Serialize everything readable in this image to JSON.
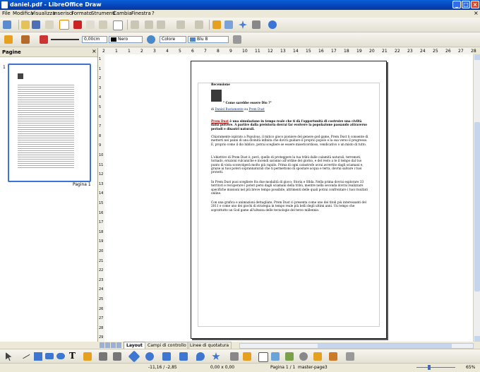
{
  "window": {
    "title": "daniel.pdf - LibreOffice Draw"
  },
  "menu": [
    "File",
    "Modifica",
    "Visualizza",
    "Inserisci",
    "Formato",
    "Strumenti",
    "Cambia",
    "Finestra",
    "?"
  ],
  "format_bar": {
    "line_width": "0,00cm",
    "line_color": "Nero",
    "area_style": "Colore",
    "area_color": "Blu 8"
  },
  "slide_pane": {
    "title": "Pagine",
    "page_number": "1",
    "page_label": "Pagina 1"
  },
  "ruler": {
    "labels": [
      "2",
      "1",
      "1",
      "2",
      "3",
      "4",
      "5",
      "6",
      "7",
      "8",
      "9",
      "10",
      "11",
      "12",
      "13",
      "14",
      "15",
      "16",
      "17",
      "18",
      "19",
      "20",
      "21",
      "22",
      "23",
      "24",
      "25",
      "26",
      "27",
      "28"
    ]
  },
  "vruler_labels": [
    "1",
    "1",
    "2",
    "3",
    "4",
    "5",
    "6",
    "7",
    "8",
    "9",
    "10",
    "11",
    "12",
    "13",
    "14",
    "15",
    "16",
    "17",
    "18",
    "19",
    "20",
    "21",
    "22",
    "23",
    "24",
    "25",
    "26",
    "27",
    "28",
    "29"
  ],
  "tabs": [
    "Layout",
    "Campi di controllo",
    "Linee di quotatura"
  ],
  "status": {
    "position": "-11,16 / -2,85",
    "size": "0,00 x 0,00",
    "page": "Pagina 1 / 1",
    "master": "master-page3",
    "zoom": "65%"
  },
  "doc": {
    "heading": "Recensione",
    "quote": "\" Come sarebbe essere Dio ?\"",
    "byline_prefix": "di",
    "author": "Daniel Bustamente",
    "byline_mid": "su",
    "game_link": "Prem Dust",
    "intro_bold_link": "Prem Dust",
    "intro_bold": "è una simulazione in tempo reale che ti dà l'opportunità di costruire una civiltà dalla polvere. A partire dalla preistoria dovrai far evolvere la popolazione passando attraverso periodi e disastri naturali.",
    "p1": "Chiaramente ispirato a Populous, il mitico gioco pioniere del genere god game, Prem Dust ti consente di metterti nei panni di una divinità infinita che dovrà guidare il proprio popolo e la sua verso il progresso. E, proprio come il dio biblico, potrai scegliere se essere misericordioso, vendicativo o un misto di tutto.",
    "p2": "L'obiettivo di Prem Dust è, però, quello di proteggere la tua tribù dalle calamità naturali, terremoti, tornado, eruzioni vulcaniche e incendi saranno all'ordine del giorno, e del resto a te il tempo dal tuo punto di vista sconvolgerà molto più rapido. Prima di ogni catastrofe avrai avvertito dagli sciamani e, grazie ai tuoi poteri soprannaturali che ti permettono di spostare acqua e terra, dovrai salvare i tuoi protetti.",
    "p3": "In Prem Dust puoi scegliere fra due modalità di gioco: Storia e Sfida. Nella prima dovrai esplorare 33 territori e recuperare i poteri persi dagli sciamani della tribù, mentre nella seconda dovrai realizzare specifiche missioni nel più breve tempo possibile, altrimenti delle quali potrai confrontare i tuoi risultati online.",
    "p4": "Con una grafica e animazioni dettagliate, Prem Dust ci presenta come uno dei titoli più interessanti del 2011 e come uno dei giochi di strategia in tempo reale più belli degli ultimi anni. Un tempo che soprattutto un God game all'altezza delle tecnologie del terzo millennio."
  }
}
